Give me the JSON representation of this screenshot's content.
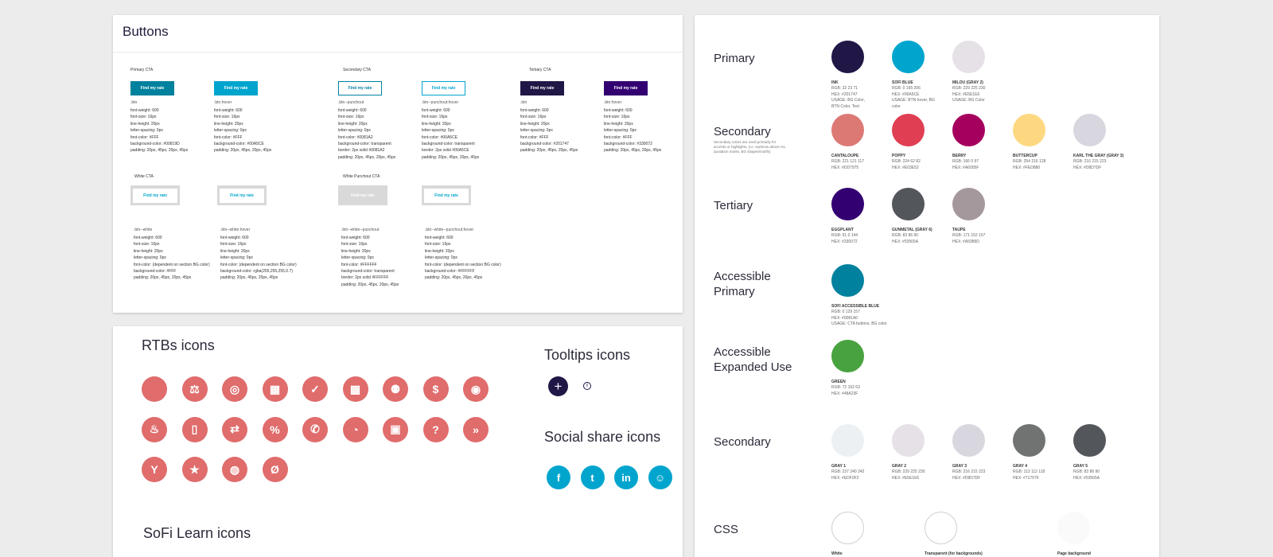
{
  "buttons_panel": {
    "title": "Buttons",
    "groups": {
      "primary": "Primary CTA",
      "secondary": "Secondary CTA",
      "tertiary": "Tertiary CTA",
      "white": "White CTA",
      "white_punchout": "White Punchout CTA"
    },
    "button_label": "Find my rate",
    "buttons": [
      {
        "class_name": ".btn",
        "bg": "#00819D",
        "text_color": "#FFFFFF",
        "border": "",
        "props": [
          "font-weight: 600",
          "font-size: 16px",
          "line-height: 20px",
          "letter-spacing: 0px",
          "font-color: #FFF",
          "background-color: #00819D",
          "padding: 20px, 45px, 20px, 45px"
        ]
      },
      {
        "class_name": ".btn:hover",
        "bg": "#00A5CE",
        "text_color": "#FFFFFF",
        "border": "",
        "props": [
          "font-weight: 600",
          "font-size: 16px",
          "line-height: 20px",
          "letter-spacing: 0px",
          "font-color: #FFF",
          "background-color: #00A5CE",
          "padding: 20px, 45px, 20px, 45px"
        ]
      },
      {
        "class_name": ".btn--punchout",
        "bg": "#FFFFFF",
        "text_color": "#0081A2",
        "border": "#0081A2",
        "props": [
          "font-weight: 600",
          "font-size: 16px",
          "line-height: 20px",
          "letter-spacing: 0px",
          "font-color: #0081A2",
          "background-color: transparent",
          "border: 2px solid #0081A2",
          "padding: 20px, 45px, 20px, 45px"
        ]
      },
      {
        "class_name": ".btn--punchout:hover",
        "bg": "#FFFFFF",
        "text_color": "#00A5CE",
        "border": "#00A5CE",
        "props": [
          "font-weight: 600",
          "font-size: 16px",
          "line-height: 20px",
          "letter-spacing: 0px",
          "font-color: #00A5CE",
          "background-color: transparent",
          "border: 2px solid #00A5CE",
          "padding: 20px, 45px, 20px, 45px"
        ]
      },
      {
        "class_name": ".btn",
        "bg": "#201747",
        "text_color": "#FFFFFF",
        "border": "",
        "props": [
          "font-weight: 600",
          "font-size: 16px",
          "line-height: 20px",
          "letter-spacing: 0px",
          "font-color: #FFF",
          "background-color: #201747",
          "padding: 20px, 45px, 20px, 45px"
        ]
      },
      {
        "class_name": ".btn:hover",
        "bg": "#330072",
        "text_color": "#FFFFFF",
        "border": "",
        "props": [
          "font-weight: 600",
          "font-size: 16px",
          "line-height: 20px",
          "letter-spacing: 0px",
          "font-color: #FFF",
          "background-color: #330072",
          "padding: 20px, 45px, 20px, 45px"
        ]
      },
      {
        "class_name": ".btn--white",
        "bg": "#FFFFFF",
        "text_color": "#00A5CE",
        "border": "",
        "props": [
          "font-weight: 600",
          "font-size: 16px",
          "line-height: 20px",
          "letter-spacing: 0px",
          "font-color: (dependent on section BG color)",
          "background-color: #FFF",
          "padding: 20px, 45px, 20px, 45px"
        ]
      },
      {
        "class_name": ".btn--white:hover",
        "bg": "#FFFFFF",
        "text_color": "#00A5CE",
        "border": "",
        "props": [
          "font-weight: 600",
          "font-size: 16px",
          "line-height: 20px",
          "letter-spacing: 0px",
          "font-color: (dependent on section BG color)",
          "background-color: rgba(255,255,255,0.7)",
          "padding: 20px, 45px, 20px, 45px"
        ]
      },
      {
        "class_name": ".btn--white--punchout",
        "bg": "#D9D9D9",
        "text_color": "#FFFFFF",
        "border": "",
        "props": [
          "font-weight: 600",
          "font-size: 16px",
          "line-height: 20px",
          "letter-spacing: 0px",
          "font-color: #FFFFFF",
          "background-color: transparent",
          "border: 2px solid #FFFFFF",
          "padding: 20px, 45px, 20px, 45px"
        ]
      },
      {
        "class_name": ".btn--white--punchout:hover",
        "bg": "#FFFFFF",
        "text_color": "#00A5CE",
        "border": "",
        "props": [
          "font-weight: 600",
          "font-size: 16px",
          "line-height: 20px",
          "letter-spacing: 0px",
          "font-color: (dependent on section BG color)",
          "background-color: #FFFFFF",
          "padding: 20px, 45px, 20px, 45px"
        ]
      }
    ]
  },
  "icons_panel": {
    "rtbs_title": "RTBs icons",
    "tooltips_title": "Tooltips icons",
    "social_title": "Social share icons",
    "learn_title": "SoFi Learn icons",
    "icon_color": "#E06C6C",
    "rtb_icons": [
      "blank-icon",
      "seesaw-icon",
      "target-icon",
      "calendar-check-icon",
      "check-icon",
      "grid-icon",
      "people-icon",
      "dollar-icon",
      "eye-icon",
      "flame-icon",
      "phone-icon",
      "transfer-icon",
      "percent-icon",
      "call-icon",
      "pie-chart-icon",
      "briefcase-icon",
      "question-icon",
      "fast-forward-icon",
      "split-arrow-icon",
      "star-icon",
      "fingerprint-icon",
      "no-fee-icon"
    ],
    "rtb_glyphs": [
      "",
      "⚖",
      "◎",
      "▦",
      "✓",
      "▩",
      "⚉",
      "$",
      "◉",
      "♨",
      "▯",
      "⇄",
      "%",
      "✆",
      "◔",
      "▣",
      "?",
      "»",
      "Y",
      "★",
      "◍",
      "Ø"
    ],
    "tooltip_plus": "+",
    "tooltip_info": "i",
    "social": [
      {
        "name": "facebook-icon",
        "glyph": "f"
      },
      {
        "name": "twitter-icon",
        "glyph": "t"
      },
      {
        "name": "linkedin-icon",
        "glyph": "in"
      },
      {
        "name": "reddit-icon",
        "glyph": "☺"
      }
    ]
  },
  "colors_panel": {
    "rows": [
      {
        "label": "Primary",
        "note": "",
        "swatches": [
          {
            "name": "INK",
            "color": "#201747",
            "border": false,
            "info": [
              "RGB: 32 23 71",
              "HEX: #201747",
              "USAGE: BG Color,",
              "BTN Color, Text"
            ]
          },
          {
            "name": "SOFI BLUE",
            "color": "#00A5CE",
            "border": false,
            "info": [
              "RGB: 0 165 206",
              "HEX: #00A5CE",
              "USAGE: BTN hover, BG",
              "color"
            ]
          },
          {
            "name": "MILOU (GRAY 2)",
            "color": "#E5E1E6",
            "border": false,
            "info": [
              "RGB: 229 225 230",
              "HEX: #E5E1E6",
              "USAGE: BG Color"
            ]
          }
        ]
      },
      {
        "label": "Secondary",
        "note": "Secondary colors are used primarily for accents or highlights, (i.e. eyebrow above H1, quotation marks, BG shapes/motifs)",
        "swatches": [
          {
            "name": "CANTALOUPE",
            "color": "#DD7975",
            "border": false,
            "info": [
              "RGB: 221 121 117",
              "HEX: #DD7975"
            ]
          },
          {
            "name": "POPPY",
            "color": "#E03E52",
            "border": false,
            "info": [
              "RGB: 224 62 82",
              "HEX: #E03E52"
            ]
          },
          {
            "name": "BERRY",
            "color": "#A6005F",
            "border": false,
            "info": [
              "RGB: 166 0 97",
              "HEX: #A6005F"
            ]
          },
          {
            "name": "BUTTERCUP",
            "color": "#FED880",
            "border": false,
            "info": [
              "RGB: 254 216 128",
              "HEX: #FED880"
            ]
          },
          {
            "name": "KARL THE GRAY (GRAY 3)",
            "color": "#D8D7DF",
            "border": false,
            "info": [
              "RGB: 216 215 223",
              "HEX: #D8D7DF"
            ]
          }
        ]
      },
      {
        "label": "Tertiary",
        "note": "",
        "swatches": [
          {
            "name": "EGGPLANT",
            "color": "#330072",
            "border": false,
            "info": [
              "RGB: 51 0 144",
              "HEX: #330072"
            ]
          },
          {
            "name": "GUNMETAL (GRAY 6)",
            "color": "#53565A",
            "border": false,
            "info": [
              "RGB: 83 86 90",
              "HEX: #53565A"
            ]
          },
          {
            "name": "TAUPE",
            "color": "#A5989D",
            "border": false,
            "info": [
              "RGB: 171 152 157",
              "HEX: #A5989D"
            ]
          }
        ]
      },
      {
        "label": "Accessible Primary",
        "note": "",
        "swatches": [
          {
            "name": "SOFI ACCESSIBLE BLUE",
            "color": "#00819D",
            "border": false,
            "info": [
              "RGB: 0 129 157",
              "HEX: #0081A0",
              "USAGE: CTA buttons, BG color"
            ]
          }
        ]
      },
      {
        "label": "Accessible Expanded Use",
        "note": "",
        "swatches": [
          {
            "name": "GREEN",
            "color": "#48A23F",
            "border": false,
            "info": [
              "RGB: 72 162 63",
              "HEX: #48A23F"
            ]
          }
        ]
      },
      {
        "label": "Secondary",
        "note": "",
        "swatches": [
          {
            "name": "GRAY 1",
            "color": "#EDF0F2",
            "border": false,
            "info": [
              "RGB: 237 240 242",
              "HEX: #EDF0F2"
            ]
          },
          {
            "name": "GRAY 2",
            "color": "#E5E1E6",
            "border": false,
            "info": [
              "RGB: 229 225 230",
              "HEX: #E5E1E6"
            ]
          },
          {
            "name": "GRAY 3",
            "color": "#D8D7DF",
            "border": false,
            "info": [
              "RGB: 216 215 223",
              "HEX: #D8D7DF"
            ]
          },
          {
            "name": "GRAY 4",
            "color": "#707372",
            "border": false,
            "info": [
              "RGB: 113 112 118",
              "HEX: #717076"
            ]
          },
          {
            "name": "GRAY 5",
            "color": "#53565A",
            "border": false,
            "info": [
              "RGB: 83 86 90",
              "HEX: #53565A"
            ]
          }
        ]
      },
      {
        "label": "CSS",
        "note": "",
        "swatches": [
          {
            "name": "White",
            "color": "#FFFFFF",
            "border": true,
            "info": []
          },
          {
            "name": "Transparent (for backgrounds)",
            "color": "#FFFFFF",
            "border": true,
            "info": []
          },
          {
            "name": "Page background",
            "color": "#FAFAFA",
            "border": false,
            "info": []
          }
        ]
      }
    ]
  }
}
